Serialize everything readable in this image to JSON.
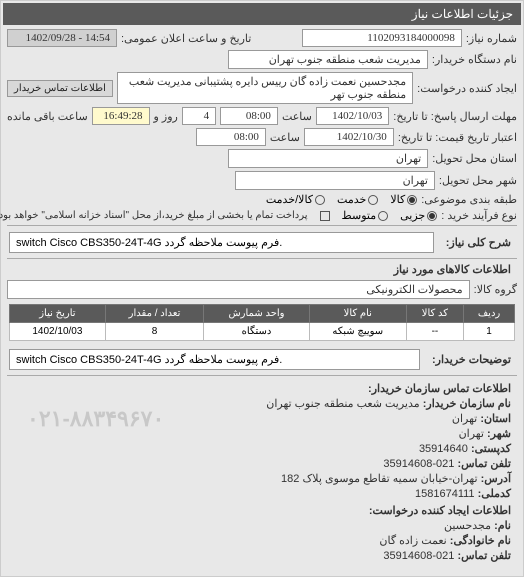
{
  "header": {
    "title": "جزئیات اطلاعات نیاز"
  },
  "form": {
    "req_no_label": "شماره نیاز:",
    "req_no": "1102093184000098",
    "announce_label": "تاریخ و ساعت اعلان عمومی:",
    "announce_value": "14:54 - 1402/09/28",
    "buyer_org_label": "نام دستگاه خریدار:",
    "buyer_org": "مدیریت شعب منطقه جنوب تهران",
    "requester_label": "ایجاد کننده درخواست:",
    "requester": "مجدحسین نعمت زاده گان رییس دایره پشتیبانی مدیریت شعب منطقه جنوب تهر",
    "contact_link": "اطلاعات تماس خریدار",
    "reply_deadline_label": "مهلت ارسال پاسخ: تا تاریخ:",
    "reply_date": "1402/10/03",
    "reply_time_label": "ساعت",
    "reply_time": "08:00",
    "day_label": "روز و",
    "day_value": "4",
    "remain_label": "ساعت باقی مانده",
    "remain_time": "16:49:28",
    "validity_label": "اعتبار تاریخ قیمت: تا تاریخ:",
    "validity_date": "1402/10/30",
    "validity_time": "08:00",
    "province_label": "استان محل تحویل:",
    "province": "تهران",
    "city_label": "شهر محل تحویل:",
    "city": "تهران",
    "topic_class_label": "طبقه بندی موضوعی:",
    "radio_kala": "کالا",
    "radio_khadamat": "خدمت",
    "radio_kala_khadamat": "کالا/خدمت",
    "purchase_type_label": "نوع فرآیند خرید :",
    "radio_jozi": "جزیی",
    "radio_motavaset": "متوسط",
    "purchase_note": "پرداخت تمام یا بخشی از مبلغ خرید،از محل \"اسناد خزانه اسلامی\" خواهد بود.",
    "demand_title_label": "شرح کلی نیاز:",
    "demand_title": "switch Cisco CBS350-24T-4G فرم پیوست ملاحظه گردد."
  },
  "items_section": {
    "heading": "اطلاعات کالاهای مورد نیاز",
    "group_label": "گروه کالا:",
    "group_value": "محصولات الکترونیکی",
    "columns": [
      "ردیف",
      "کد کالا",
      "نام کالا",
      "واحد شمارش",
      "تعداد / مقدار",
      "تاریخ نیاز"
    ],
    "rows": [
      {
        "idx": "1",
        "code": "--",
        "name": "سوییچ شبکه",
        "unit": "دستگاه",
        "qty": "8",
        "date": "1402/10/03"
      }
    ],
    "buyer_desc_label": "توضیحات خریدار:",
    "buyer_desc": "switch Cisco CBS350-24T-4G فرم پیوست ملاحظه گردد."
  },
  "contact": {
    "heading": "اطلاعات تماس سازمان خریدار:",
    "org_label": "نام سازمان خریدار:",
    "org": "مدیریت شعب منطقه جنوب تهران",
    "province_label": "استان:",
    "province": "تهران",
    "city_label": "شهر:",
    "city": "تهران",
    "postal_label": "کدپستی:",
    "postal": "35914640",
    "phone_label": "تلفن تماس:",
    "phone": "021-35914608",
    "address_label": "آدرس:",
    "address": "تهران-خیابان سمیه تقاطع موسوی پلاک 182",
    "natid_label": "کدملی:",
    "natid": "1581674111",
    "creator_heading": "اطلاعات ایجاد کننده درخواست:",
    "name_label": "نام:",
    "name": "مجدحسین",
    "family_label": "نام خانوادگی:",
    "family": "نعمت زاده گان",
    "cphone_label": "تلفن تماس:",
    "cphone": "021-35914608",
    "watermark": "۰۲۱-۸۸۳۴۹۶۷۰"
  }
}
